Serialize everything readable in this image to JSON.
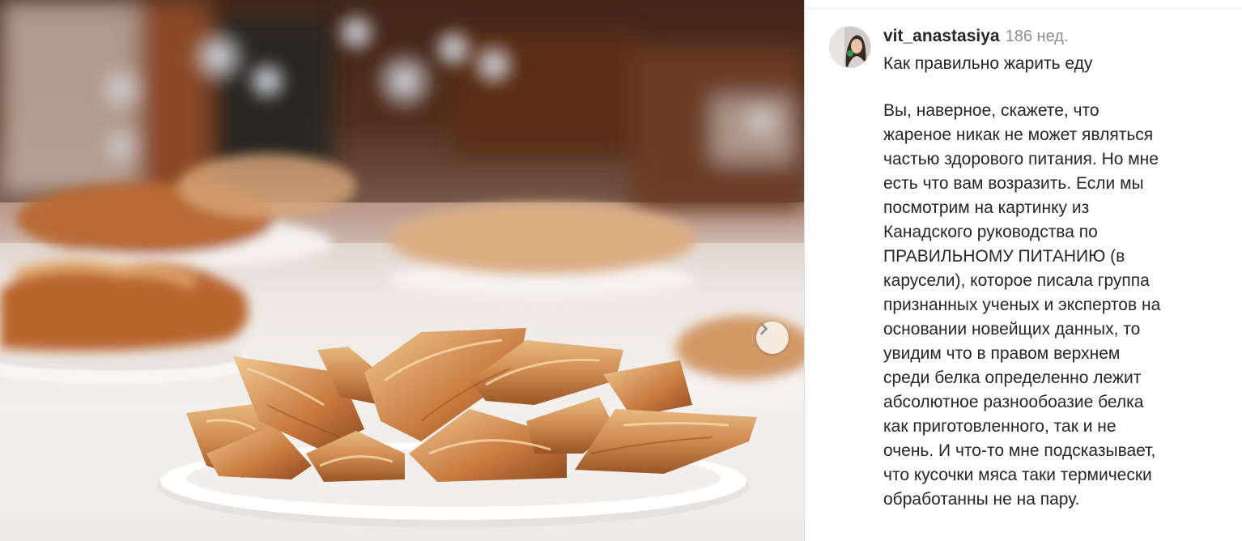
{
  "photo": {
    "alt": "",
    "next_icon": "chevron-right-icon"
  },
  "post": {
    "username": "vit_anastasiya",
    "time_ago": "186 нед.",
    "caption_title": "Как правильно жарить еду",
    "caption_lines": [
      "Вы, наверное, скажете, что",
      "жареное никак не может являться",
      "частью здорового питания. Но мне",
      "есть что вам возразить. Если мы",
      "посмотрим на картинку из",
      "Канадского руководства по",
      "ПРАВИЛЬНОМУ ПИТАНИЮ (в",
      "карусели), которое писала группа",
      "признанных ученых и экспертов на",
      "основании новейщих данных, то",
      "увидим что в правом верхнем",
      "среди белка определенно лежит",
      "абсолютное разнообоазие белка",
      "как приготовленного, так и не",
      "очень. И что-то мне подсказывает,",
      "что кусочки мяса таки термически",
      "обработанны не на пару."
    ]
  },
  "colors": {
    "text": "#262626",
    "muted": "#8e8e8e",
    "border": "#dbdbdb"
  }
}
